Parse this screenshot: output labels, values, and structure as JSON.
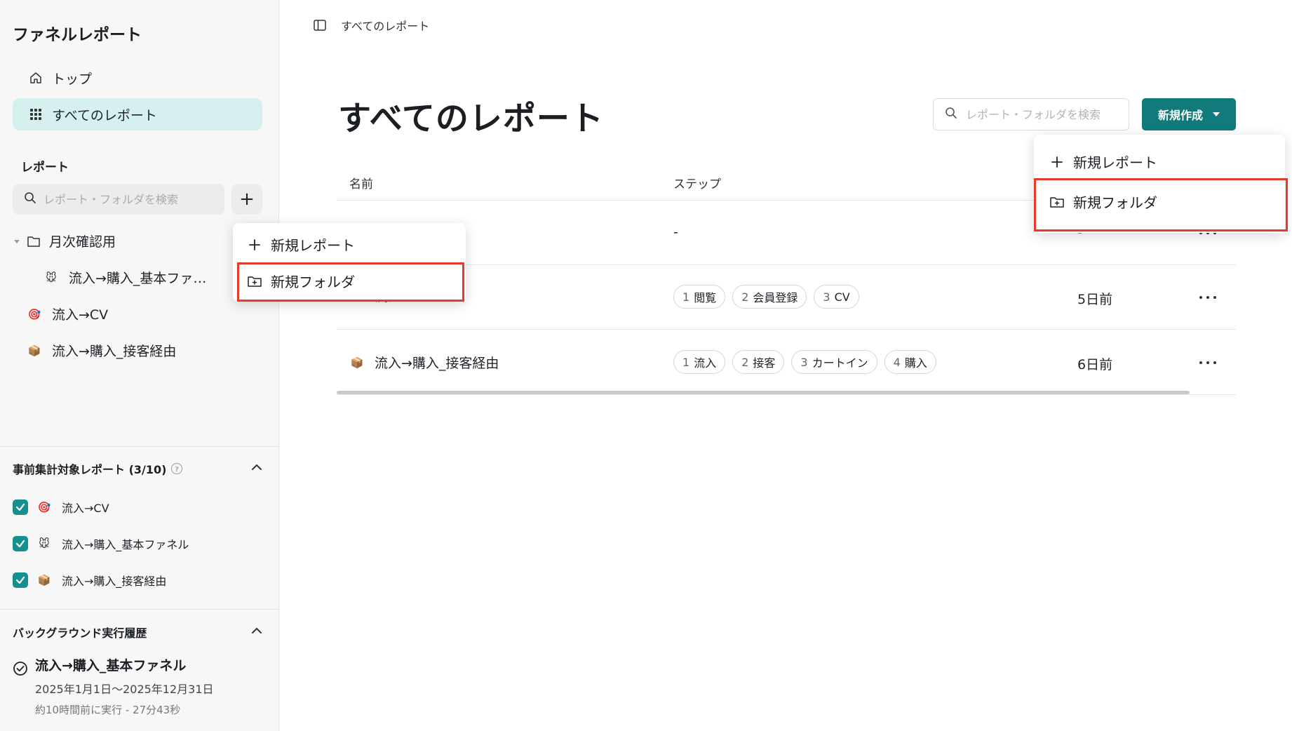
{
  "sidebar": {
    "app_title": "ファネルレポート",
    "nav": [
      {
        "label": "トップ",
        "icon": "home-icon"
      },
      {
        "label": "すべてのレポート",
        "icon": "grid-icon",
        "active": true
      }
    ],
    "section_label": "レポート",
    "search_placeholder": "レポート・フォルダを検索",
    "add_label": "+",
    "tree": {
      "folder": {
        "label": "月次確認用",
        "icon": "folder-icon",
        "expanded": true
      },
      "folder_items": [
        {
          "label": "流入→購入_基本ファ…",
          "emoji": "🐭"
        }
      ],
      "items": [
        {
          "label": "流入→CV",
          "emoji": "🎯"
        },
        {
          "label": "流入→購入_接客経由",
          "emoji": "📦"
        }
      ]
    },
    "precompute": {
      "title": "事前集計対象レポート (3/10)",
      "items": [
        {
          "label": "流入→CV",
          "emoji": "🎯",
          "checked": true
        },
        {
          "label": "流入→購入_基本ファネル",
          "emoji": "🐭",
          "checked": true
        },
        {
          "label": "流入→購入_接客経由",
          "emoji": "📦",
          "checked": true
        }
      ]
    },
    "background": {
      "title": "バックグラウンド実行履歴",
      "job": {
        "name": "流入→購入_基本ファネル",
        "range": "2025年1月1日〜2025年12月31日",
        "status": "約10時間前に実行 - 27分43秒"
      }
    }
  },
  "sidebar_menu": {
    "new_report": "新規レポート",
    "new_folder": "新規フォルダ"
  },
  "main": {
    "breadcrumb": "すべてのレポート",
    "title": "すべてのレポート",
    "search_placeholder": "レポート・フォルダを検索",
    "create_button": "新規作成",
    "columns": {
      "name": "名前",
      "steps": "ステップ"
    },
    "rows": [
      {
        "name": "",
        "steps_text": "-",
        "updated": "-"
      },
      {
        "name": "流入→CV",
        "steps": [
          {
            "n": "1",
            "label": "閲覧"
          },
          {
            "n": "2",
            "label": "会員登録"
          },
          {
            "n": "3",
            "label": "CV"
          }
        ],
        "updated": "5日前"
      },
      {
        "name": "流入→購入_接客経由",
        "emoji": "📦",
        "steps": [
          {
            "n": "1",
            "label": "流入"
          },
          {
            "n": "2",
            "label": "接客"
          },
          {
            "n": "3",
            "label": "カートイン"
          },
          {
            "n": "4",
            "label": "購入"
          }
        ],
        "updated": "6日前"
      }
    ]
  },
  "create_menu": {
    "new_report": "新規レポート",
    "new_folder": "新規フォルダ"
  },
  "colors": {
    "accent": "#117a7a",
    "active_nav": "#d6efef",
    "checkbox": "#15908f",
    "highlight": "#e53b2c"
  }
}
